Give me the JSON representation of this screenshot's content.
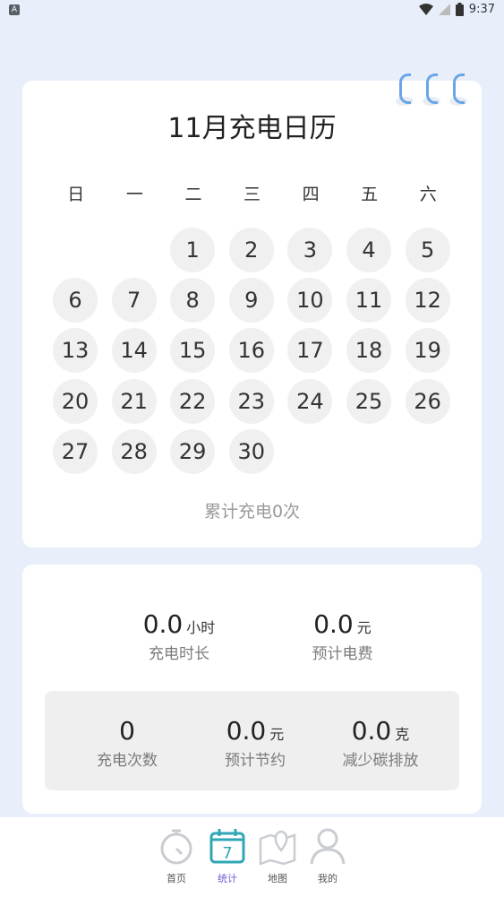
{
  "status": {
    "left_icon": "A",
    "time": "9:37"
  },
  "calendar": {
    "title": "11月充电日历",
    "weekdays": [
      "日",
      "一",
      "二",
      "三",
      "四",
      "五",
      "六"
    ],
    "days": [
      "1",
      "2",
      "3",
      "4",
      "5",
      "6",
      "7",
      "8",
      "9",
      "10",
      "11",
      "12",
      "13",
      "14",
      "15",
      "16",
      "17",
      "18",
      "19",
      "20",
      "21",
      "22",
      "23",
      "24",
      "25",
      "26",
      "27",
      "28",
      "29",
      "30"
    ],
    "total": "累计充电0次"
  },
  "stats": {
    "duration": {
      "value": "0.0",
      "unit": "小时",
      "label": "充电时长"
    },
    "fee": {
      "value": "0.0",
      "unit": "元",
      "label": "预计电费"
    },
    "count": {
      "value": "0",
      "label": "充电次数"
    },
    "saving": {
      "value": "0.0",
      "unit": "元",
      "label": "预计节约"
    },
    "carbon": {
      "value": "0.0",
      "unit": "克",
      "label": "减少碳排放"
    }
  },
  "tabs": [
    {
      "label": "首页",
      "icon": "stopwatch-icon"
    },
    {
      "label": "统计",
      "icon": "calendar-icon",
      "icon_text": "7"
    },
    {
      "label": "地图",
      "icon": "map-icon"
    },
    {
      "label": "我的",
      "icon": "person-icon"
    }
  ],
  "colors": {
    "accent": "#2fa7b5",
    "active_tab": "#6b5fd0",
    "ring": "#6aa6e6"
  }
}
